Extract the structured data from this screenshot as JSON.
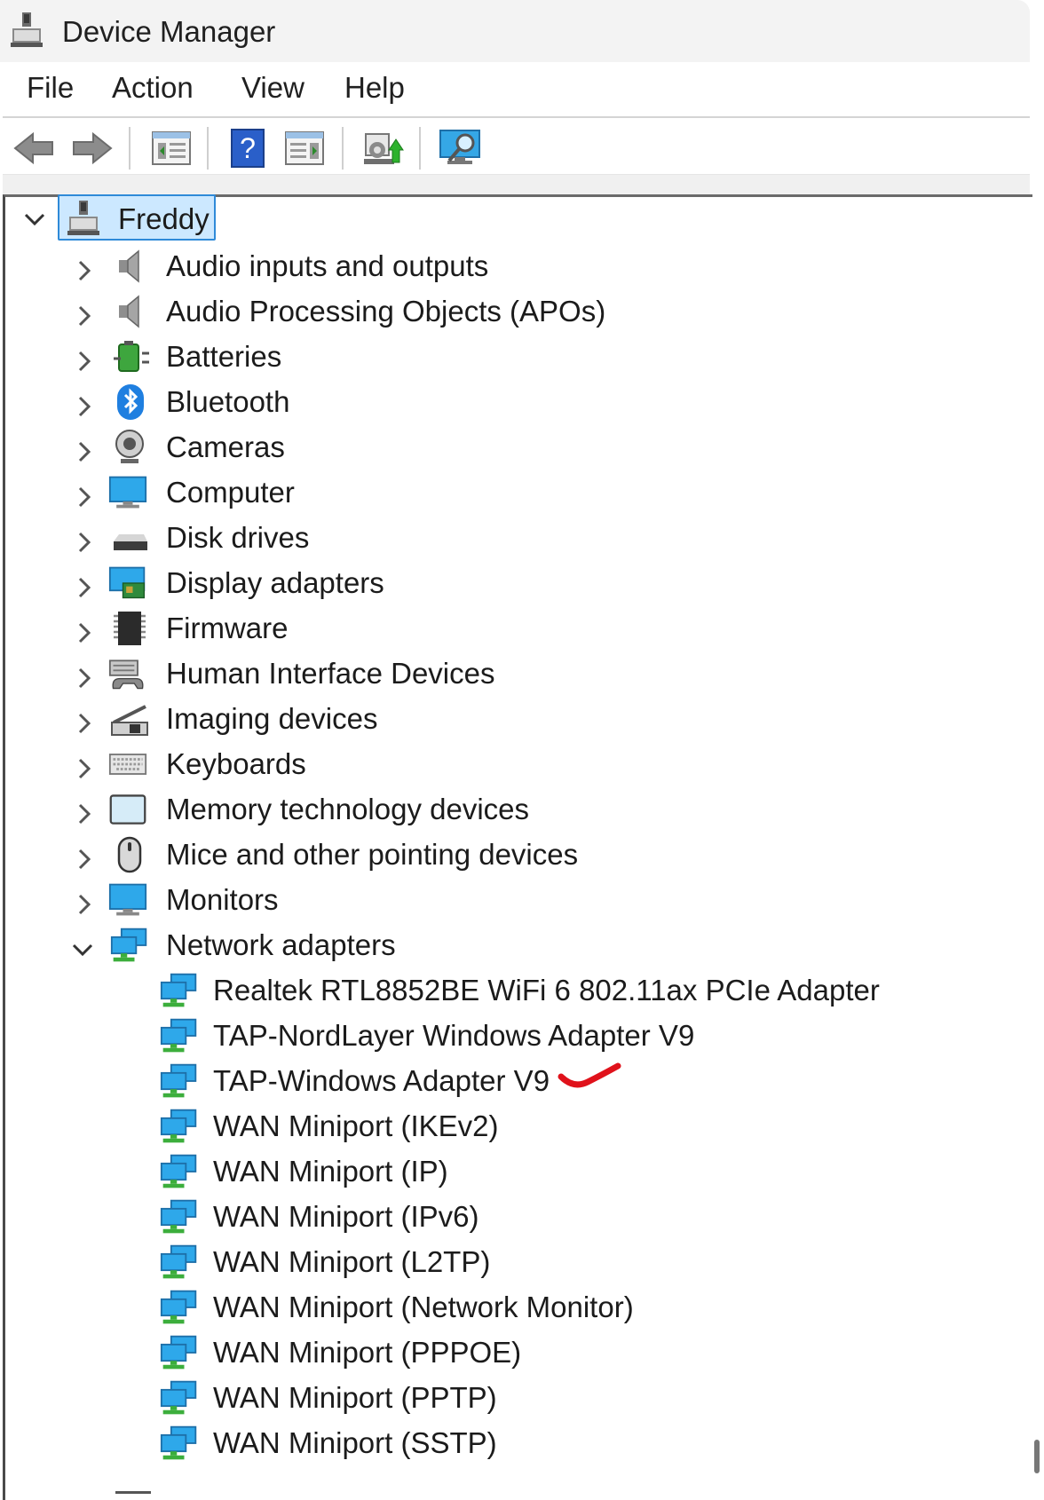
{
  "window": {
    "title": "Device Manager"
  },
  "menu": [
    "File",
    "Action",
    "View",
    "Help"
  ],
  "toolbar": {
    "buttons": [
      "back-icon",
      "forward-icon",
      "properties-icon",
      "help-icon",
      "action-pane-icon",
      "update-driver-icon",
      "scan-hardware-icon"
    ]
  },
  "tree": {
    "root": "Freddy",
    "categories": [
      "Audio inputs and outputs",
      "Audio Processing Objects (APOs)",
      "Batteries",
      "Bluetooth",
      "Cameras",
      "Computer",
      "Disk drives",
      "Display adapters",
      "Firmware",
      "Human Interface Devices",
      "Imaging devices",
      "Keyboards",
      "Memory technology devices",
      "Mice and other pointing devices",
      "Monitors",
      "Network adapters"
    ],
    "network_adapters": [
      "Realtek RTL8852BE WiFi 6 802.11ax PCIe Adapter",
      "TAP-NordLayer Windows Adapter V9",
      "TAP-Windows Adapter V9",
      "WAN Miniport (IKEv2)",
      "WAN Miniport (IP)",
      "WAN Miniport (IPv6)",
      "WAN Miniport (L2TP)",
      "WAN Miniport (Network Monitor)",
      "WAN Miniport (PPPOE)",
      "WAN Miniport (PPTP)",
      "WAN Miniport (SSTP)"
    ]
  },
  "colors": {
    "selection": "#cce8ff",
    "selection_border": "#2f8ad8",
    "annotation": "#e0121b"
  }
}
